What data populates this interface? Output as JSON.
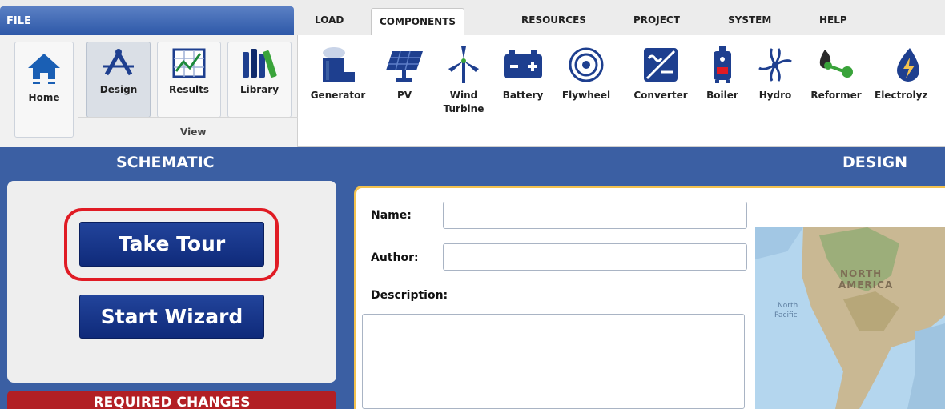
{
  "tabs": {
    "file": "FILE",
    "items": [
      "LOAD",
      "COMPONENTS",
      "RESOURCES",
      "PROJECT",
      "SYSTEM",
      "HELP"
    ],
    "active": "COMPONENTS"
  },
  "ribbon": {
    "home": "Home",
    "view_buttons": [
      "Design",
      "Results",
      "Library"
    ],
    "view_group_label": "View",
    "components": [
      "Generator",
      "PV",
      "Wind Turbine",
      "Battery",
      "Flywheel",
      "Converter",
      "Boiler",
      "Hydro",
      "Reformer",
      "Electrolyz"
    ]
  },
  "headers": {
    "left": "SCHEMATIC",
    "right": "DESIGN"
  },
  "schematic": {
    "take_tour": "Take Tour",
    "start_wizard": "Start Wizard",
    "required_changes": "REQUIRED CHANGES"
  },
  "design": {
    "name_label": "Name:",
    "name_value": "",
    "author_label": "Author:",
    "author_value": "",
    "description_label": "Description:",
    "description_value": "",
    "map_labels": [
      "NORTH",
      "AMERICA",
      "North",
      "Pacific"
    ]
  },
  "colors": {
    "primary_blue": "#3b5fa3",
    "button_blue": "#1a3a8f",
    "highlight_red": "#e01b24",
    "required_red": "#b21f24",
    "card_border": "#f3c24f"
  }
}
